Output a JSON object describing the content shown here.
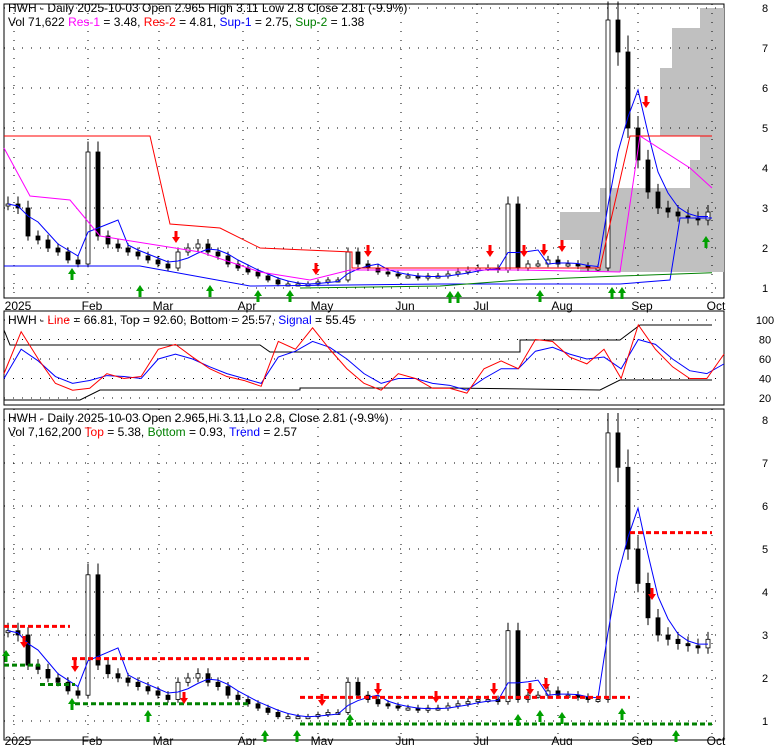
{
  "panel1": {
    "line1": "HWH - Daily 2025-10-03 Open 2.965  High 3.11  Low 2.8  Close 2.81 (-9.9%)",
    "vol": "Vol 71,622",
    "res1_label": "Res-1",
    "res1_value": " = 3.48, ",
    "res2_label": "Res-2",
    "res2_value": " = 4.81, ",
    "sup1_label": "Sup-1",
    "sup1_value": " = 2.75, ",
    "sup2_label": "Sup-2",
    "sup2_value": " = 1.38"
  },
  "panel2": {
    "name": "HWH - ",
    "line_label": "Line",
    "line_value": " = 66.81, Top = 92.60, Bottom = 25.57, ",
    "signal_label": "Signal",
    "signal_value": " = 55.45"
  },
  "panel3": {
    "line1": "HWH - Daily 2025-10-03 Open 2.965,Hi 3.11,Lo 2.8, Close 2.81 (-9.9%)",
    "vol": "Vol 7,162,200 ",
    "top_label": "Top",
    "top_value": " = 5.38, ",
    "bottom_label": "Bottom",
    "bottom_value": " = 0.93, ",
    "trend_label": "Trend",
    "trend_value": " = 2.57"
  },
  "chart_data": {
    "type": "line",
    "months": [
      "2025",
      "Feb",
      "Mar",
      "Apr",
      "May",
      "Jun",
      "Jul",
      "Aug",
      "Sep",
      "Oct"
    ],
    "price_ticks": [
      "1",
      "2",
      "3",
      "4",
      "5",
      "6",
      "7",
      "8"
    ],
    "osc_ticks": [
      "20",
      "40",
      "60",
      "80",
      "100"
    ],
    "closes": [
      3.1,
      3.0,
      2.3,
      2.2,
      2.0,
      1.9,
      1.7,
      1.6,
      4.4,
      2.3,
      2.1,
      2.0,
      1.9,
      1.8,
      1.7,
      1.6,
      1.5,
      1.9,
      2.0,
      2.1,
      1.9,
      1.8,
      1.6,
      1.5,
      1.4,
      1.3,
      1.2,
      1.1,
      1.1,
      1.1,
      1.1,
      1.15,
      1.2,
      1.2,
      1.9,
      1.6,
      1.5,
      1.4,
      1.35,
      1.3,
      1.3,
      1.25,
      1.3,
      1.3,
      1.35,
      1.4,
      1.45,
      1.5,
      1.5,
      1.45,
      3.1,
      1.5,
      1.6,
      1.6,
      1.7,
      1.6,
      1.6,
      1.55,
      1.5,
      1.5,
      7.7,
      6.9,
      5.0,
      4.2,
      3.4,
      3.0,
      2.9,
      2.8,
      2.75,
      2.7,
      2.9
    ],
    "osc_line": [
      45,
      88,
      60,
      35,
      28,
      30,
      45,
      40,
      42,
      70,
      75,
      62,
      50,
      42,
      38,
      32,
      78,
      70,
      92,
      70,
      50,
      35,
      28,
      45,
      40,
      30,
      30,
      25,
      50,
      58,
      50,
      80,
      78,
      62,
      55,
      70,
      40,
      95,
      70,
      52,
      40,
      40,
      65
    ],
    "osc_signal": [
      40,
      70,
      58,
      42,
      35,
      38,
      43,
      42,
      40,
      60,
      65,
      60,
      52,
      45,
      40,
      35,
      62,
      68,
      78,
      72,
      60,
      45,
      35,
      40,
      40,
      35,
      33,
      28,
      40,
      50,
      50,
      68,
      72,
      65,
      60,
      62,
      50,
      80,
      75,
      60,
      48,
      45,
      55
    ]
  }
}
